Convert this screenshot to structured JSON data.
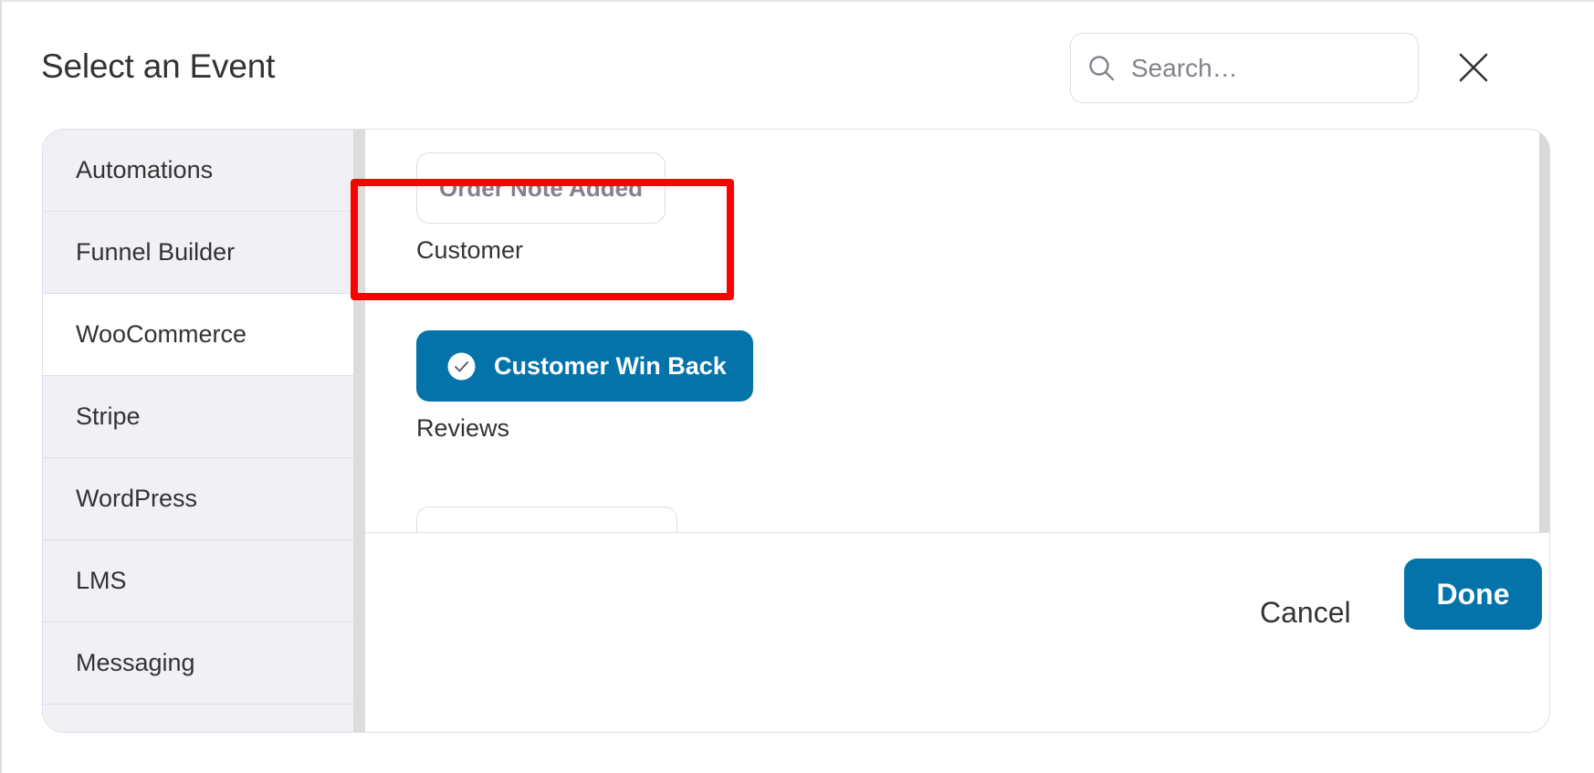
{
  "dialog": {
    "title": "Select an Event",
    "search": {
      "placeholder": "Search…",
      "value": ""
    }
  },
  "sidebar": {
    "items": [
      {
        "label": "Automations",
        "active": false
      },
      {
        "label": "Funnel Builder",
        "active": false
      },
      {
        "label": "WooCommerce",
        "active": true
      },
      {
        "label": "Stripe",
        "active": false
      },
      {
        "label": "WordPress",
        "active": false
      },
      {
        "label": "LMS",
        "active": false
      },
      {
        "label": "Messaging",
        "active": false
      }
    ]
  },
  "content": {
    "events_above": [
      {
        "label": "Order Note Added"
      }
    ],
    "sections": [
      {
        "heading": "Customer",
        "events": [
          {
            "label": "Customer Win Back",
            "selected": true
          }
        ]
      },
      {
        "heading": "Reviews",
        "events": [
          {
            "label": ""
          }
        ]
      }
    ]
  },
  "footer": {
    "cancel_label": "Cancel",
    "done_label": "Done"
  },
  "colors": {
    "accent": "#0473aa",
    "highlight": "#fe0000",
    "sidebar_bg": "#f0f0f5"
  }
}
